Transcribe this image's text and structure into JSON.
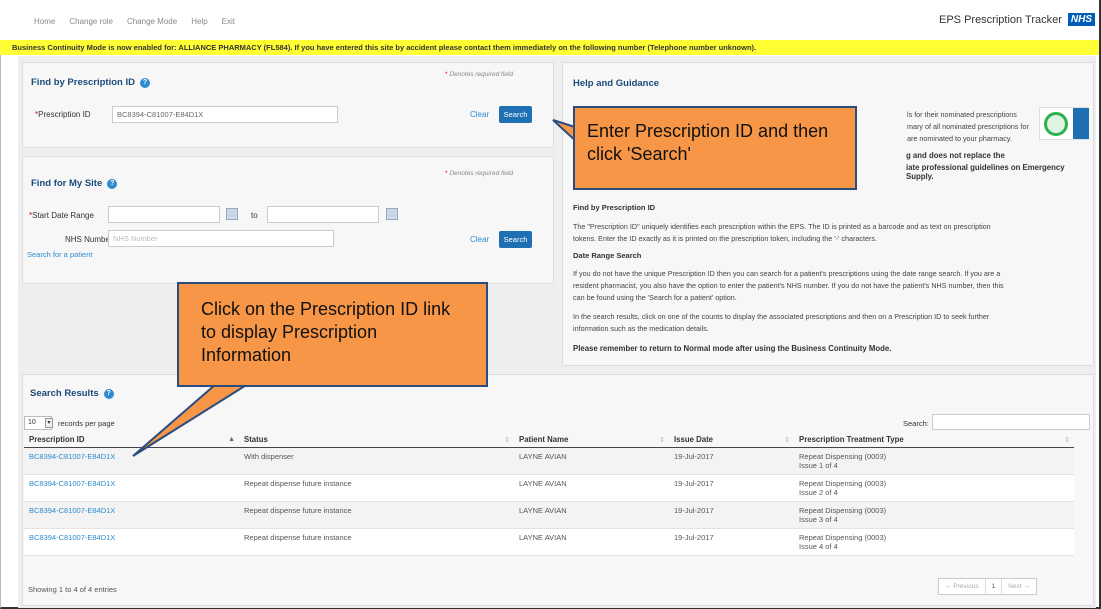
{
  "nav": {
    "links": [
      "Home",
      "Change role",
      "Change Mode",
      "Help",
      "Exit"
    ],
    "app_title": "EPS Prescription Tracker",
    "nhs_logo": "NHS"
  },
  "banner": {
    "text": "Business Continuity Mode is now enabled for: ALLIANCE PHARMACY (FL584). If you have entered this site by accident please contact them immediately on the following number (Telephone number unknown)."
  },
  "find_by_id": {
    "title": "Find by Prescription ID",
    "required_note": "Denotes required field",
    "label": "Prescription ID",
    "value": "BC8394-C81007-E84D1X",
    "clear": "Clear",
    "search": "Search"
  },
  "find_for_site": {
    "title": "Find for My Site",
    "required_note": "Denotes required field",
    "start_label": "Start Date Range",
    "to_label": "to",
    "nhs_label": "NHS Number",
    "nhs_placeholder": "NHS Number",
    "clear": "Clear",
    "search": "Search",
    "patient_link": "Search for a patient"
  },
  "guidance": {
    "title": "Help and Guidance",
    "intro_line1": "ls for their nominated prescriptions",
    "intro_line2": "mary of all nominated prescriptions for",
    "intro_line3": "are nominated to your pharmacy.",
    "bold_line1": "g and does not replace the",
    "bold_line2": "iate professional guidelines on Emergency Supply.",
    "find_heading": "Find by Prescription ID",
    "find_text1": "The \"Prescription ID\" uniquely identifies each prescription within the EPS. The ID is printed as a barcode and as text on prescription",
    "find_text2": "tokens. Enter the ID exactly as it is printed on the prescription token, including the '-' characters.",
    "date_heading": "Date Range Search",
    "date_text1": "If you do not have the unique Prescription ID then you can search for a patient's prescriptions using the date range search. If you are a",
    "date_text2": "resident pharmacist, you also have the option to enter the patient's NHS number. If you do not have the patient's NHS number, then this",
    "date_text3": "can be found using the 'Search for a patient' option.",
    "results_text1": "In the search results, click on one of the counts to display the associated prescriptions and then on a Prescription ID to seek further",
    "results_text2": "information such as the medication details.",
    "reminder": "Please remember to return to Normal mode after using the Business Continuity Mode."
  },
  "callouts": {
    "enter_id": "Enter Prescription ID and then click 'Search'",
    "click_link": "Click on the Prescription ID link to display Prescription Information"
  },
  "results": {
    "title": "Search Results",
    "page_size": "10",
    "page_size_label": "records per page",
    "search_label": "Search:",
    "columns": [
      "Prescription ID",
      "Status",
      "Patient Name",
      "Issue Date",
      "Prescription Treatment Type"
    ],
    "rows": [
      {
        "id": "BC8394-C81007-E84D1X",
        "status": "With dispenser",
        "patient": "LAYNE AVIAN",
        "date": "19-Jul-2017",
        "type": "Repeat Dispensing (0003)",
        "issue": "Issue 1 of 4"
      },
      {
        "id": "BC8394-C81007-E84D1X",
        "status": "Repeat dispense future instance",
        "patient": "LAYNE AVIAN",
        "date": "19-Jul-2017",
        "type": "Repeat Dispensing (0003)",
        "issue": "Issue 2 of 4"
      },
      {
        "id": "BC8394-C81007-E84D1X",
        "status": "Repeat dispense future instance",
        "patient": "LAYNE AVIAN",
        "date": "19-Jul-2017",
        "type": "Repeat Dispensing (0003)",
        "issue": "Issue 3 of 4"
      },
      {
        "id": "BC8394-C81007-E84D1X",
        "status": "Repeat dispense future instance",
        "patient": "LAYNE AVIAN",
        "date": "19-Jul-2017",
        "type": "Repeat Dispensing (0003)",
        "issue": "Issue 4 of 4"
      }
    ],
    "showing": "Showing 1 to 4 of 4 entries",
    "prev": "← Previous",
    "page": "1",
    "next": "Next →"
  }
}
